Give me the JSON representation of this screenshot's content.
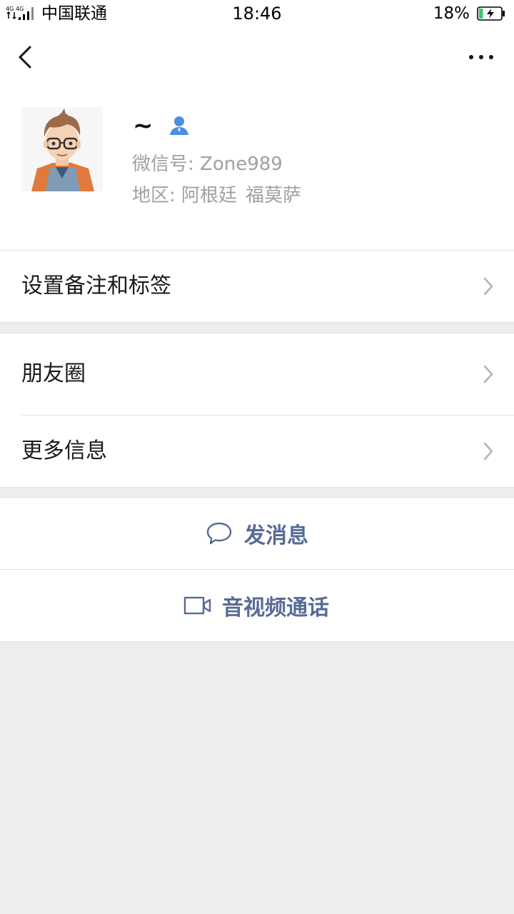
{
  "status_bar": {
    "network_label": "4G 4G",
    "carrier": "中国联通",
    "time": "18:46",
    "battery": "18%",
    "battery_fill": 0.18,
    "battery_color": "#2ecc71"
  },
  "nav": {
    "back_icon": "back-chevron-icon",
    "more_icon": "more-dots-icon"
  },
  "profile": {
    "nickname": "~",
    "contact_icon": "contact-person-icon",
    "wechat_id_label": "微信号:",
    "wechat_id": "Zone989",
    "region_label": "地区:",
    "region_country": "阿根廷",
    "region_city": "福莫萨"
  },
  "cells": {
    "remark": "设置备注和标签",
    "moments": "朋友圈",
    "more_info": "更多信息"
  },
  "actions": {
    "message": "发消息",
    "call": "音视频通话"
  },
  "colors": {
    "link_blue": "#576b95",
    "contact_blue": "#4a90e2",
    "background": "#ededed"
  }
}
